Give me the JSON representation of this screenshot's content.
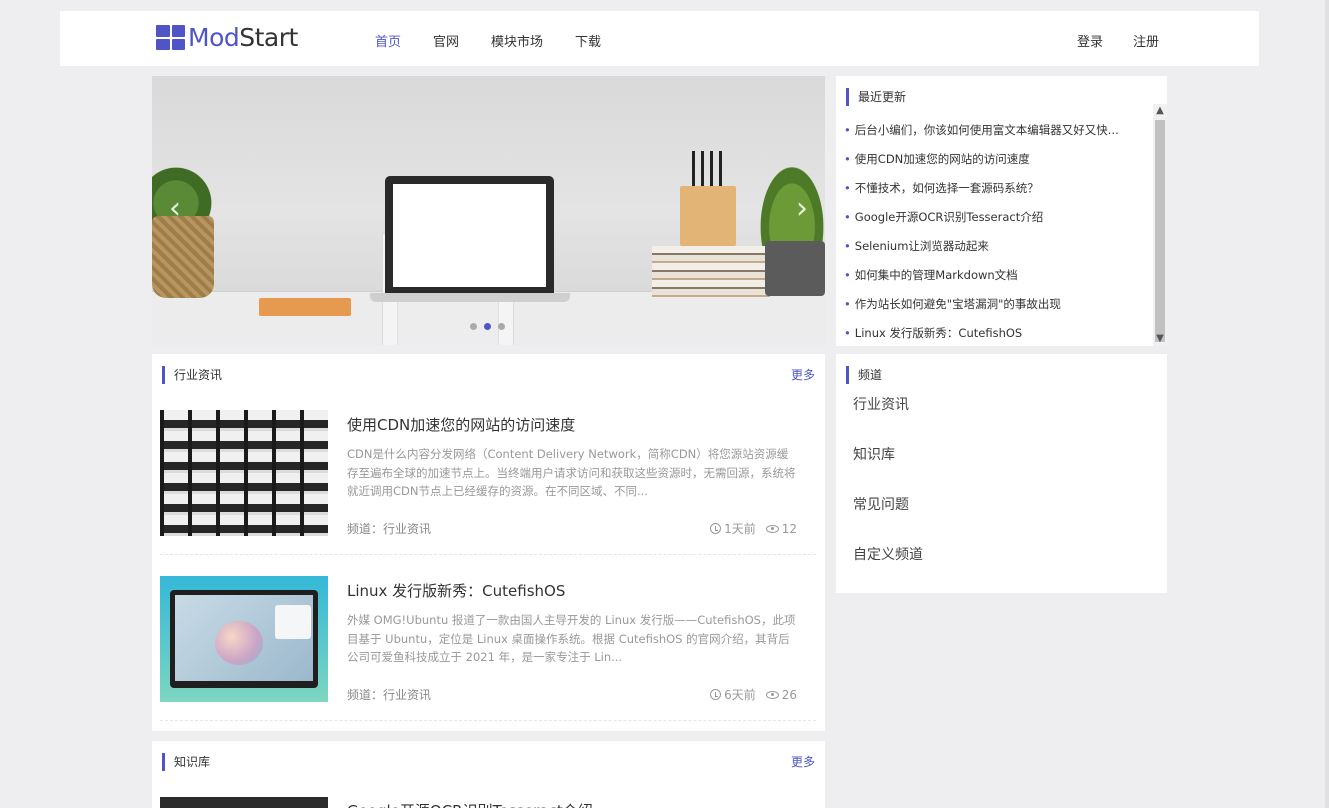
{
  "header": {
    "logo_mod": "Mod",
    "logo_start": "Start",
    "nav": [
      "首页",
      "官网",
      "模块市场",
      "下载"
    ],
    "nav_active": 0,
    "login": "登录",
    "register": "注册"
  },
  "carousel": {
    "prev_glyph": "‹",
    "next_glyph": "›",
    "slide_count": 3,
    "active_slide": 1
  },
  "recent": {
    "title": "最近更新",
    "items": [
      "后台小编们，你该如何使用富文本编辑器又好又快...",
      "使用CDN加速您的网站的访问速度",
      "不懂技术，如何选择一套源码系统？",
      "Google开源OCR识别Tesseract介绍",
      "Selenium让浏览器动起来",
      "如何集中的管理Markdown文档",
      "作为站长如何避免\"宝塔漏洞\"的事故出现",
      "Linux 发行版新秀：CutefishOS"
    ]
  },
  "channels": {
    "title": "频道",
    "items": [
      "行业资讯",
      "知识库",
      "常见问题",
      "自定义频道"
    ]
  },
  "news": {
    "title": "行业资讯",
    "more": "更多",
    "articles": [
      {
        "title": "使用CDN加速您的网站的访问速度",
        "desc": "CDN是什么内容分发网络（Content Delivery Network，简称CDN）将您源站资源缓存至遍布全球的加速节点上。当终端用户请求访问和获取这些资源时，无需回源，系统将就近调用CDN节点上已经缓存的资源。在不同区域、不同...",
        "channel_label": "频道：",
        "channel": "行业资讯",
        "time": "1天前",
        "views": "12"
      },
      {
        "title": "Linux 发行版新秀：CutefishOS",
        "desc": "外媒 OMG!Ubuntu 报道了一款由国人主导开发的 Linux 发行版——CutefishOS，此项目基于 Ubuntu，定位是 Linux 桌面操作系统。根据 CutefishOS 的官网介绍，其背后公司可爱鱼科技成立于 2021 年，是一家专注于 Lin...",
        "channel_label": "频道：",
        "channel": "行业资讯",
        "time": "6天前",
        "views": "26"
      }
    ]
  },
  "knowledge": {
    "title": "知识库",
    "more": "更多",
    "first_title": "Google开源OCR识别Tesseract介绍"
  },
  "colors": {
    "accent": "#4f55c7",
    "background": "#eeeef0"
  }
}
